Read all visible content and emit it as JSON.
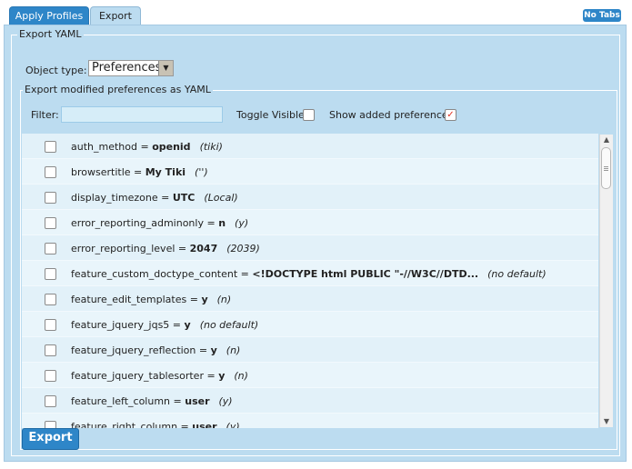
{
  "tabs": [
    {
      "label": "Apply Profiles",
      "active": false
    },
    {
      "label": "Export",
      "active": true
    }
  ],
  "no_tabs_label": "No Tabs",
  "outer_legend": "Export YAML",
  "object_type": {
    "label": "Object type:",
    "selected": "Preferences"
  },
  "inner_legend": "Export modified preferences as YAML",
  "filter": {
    "label": "Filter:",
    "value": ""
  },
  "toggle_visible": {
    "label": "Toggle Visible",
    "checked": false
  },
  "show_added": {
    "label": "Show added preferences",
    "checked": true,
    "mark": "✓"
  },
  "rows": [
    {
      "name": "auth_method = ",
      "value": "openid",
      "default": "(tiki)"
    },
    {
      "name": "browsertitle = ",
      "value": "My Tiki",
      "default": "('')"
    },
    {
      "name": "display_timezone = ",
      "value": "UTC",
      "default": "(Local)"
    },
    {
      "name": "error_reporting_adminonly = ",
      "value": "n",
      "default": "(y)"
    },
    {
      "name": "error_reporting_level = ",
      "value": "2047",
      "default": "(2039)"
    },
    {
      "name": "feature_custom_doctype_content = ",
      "value": "<!DOCTYPE html PUBLIC \"-//W3C//DTD...",
      "default": "(no default)"
    },
    {
      "name": "feature_edit_templates = ",
      "value": "y",
      "default": "(n)"
    },
    {
      "name": "feature_jquery_jqs5 = ",
      "value": "y",
      "default": "(no default)"
    },
    {
      "name": "feature_jquery_reflection = ",
      "value": "y",
      "default": "(n)"
    },
    {
      "name": "feature_jquery_tablesorter = ",
      "value": "y",
      "default": "(n)"
    },
    {
      "name": "feature_left_column = ",
      "value": "user",
      "default": "(y)"
    },
    {
      "name": "feature_right_column = ",
      "value": "user",
      "default": "(y)"
    }
  ],
  "export_button": "Export",
  "colors": {
    "accent": "#2e86c8",
    "panel": "#bcdcf0",
    "check_mark": "#e03020"
  }
}
